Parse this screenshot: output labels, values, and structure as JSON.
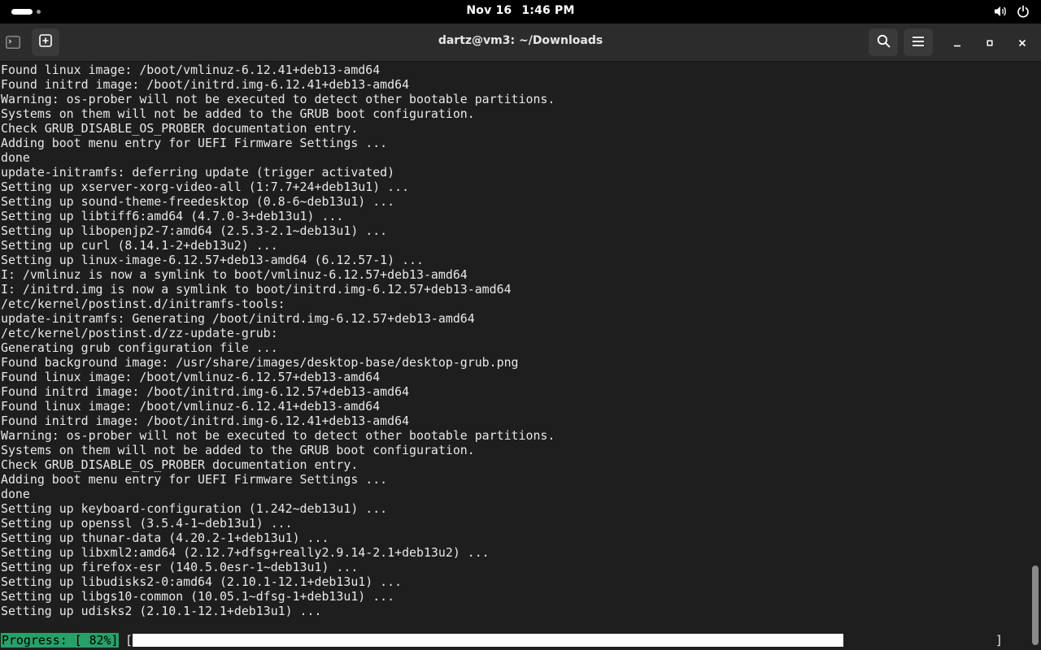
{
  "top_bar": {
    "date": "Nov 16",
    "time": "1:46 PM",
    "icons": [
      "activities-indicator",
      "volume-icon",
      "power-icon"
    ]
  },
  "window": {
    "title": "dartz@vm3: ~/Downloads",
    "icons": [
      "terminal-icon",
      "new-tab-icon",
      "search-icon",
      "hamburger-menu-icon",
      "minimize-icon",
      "maximize-icon",
      "close-icon"
    ]
  },
  "terminal": {
    "lines": [
      "Found linux image: /boot/vmlinuz-6.12.41+deb13-amd64",
      "Found initrd image: /boot/initrd.img-6.12.41+deb13-amd64",
      "Warning: os-prober will not be executed to detect other bootable partitions.",
      "Systems on them will not be added to the GRUB boot configuration.",
      "Check GRUB_DISABLE_OS_PROBER documentation entry.",
      "Adding boot menu entry for UEFI Firmware Settings ...",
      "done",
      "update-initramfs: deferring update (trigger activated)",
      "Setting up xserver-xorg-video-all (1:7.7+24+deb13u1) ...",
      "Setting up sound-theme-freedesktop (0.8-6~deb13u1) ...",
      "Setting up libtiff6:amd64 (4.7.0-3+deb13u1) ...",
      "Setting up libopenjp2-7:amd64 (2.5.3-2.1~deb13u1) ...",
      "Setting up curl (8.14.1-2+deb13u2) ...",
      "Setting up linux-image-6.12.57+deb13-amd64 (6.12.57-1) ...",
      "I: /vmlinuz is now a symlink to boot/vmlinuz-6.12.57+deb13-amd64",
      "I: /initrd.img is now a symlink to boot/initrd.img-6.12.57+deb13-amd64",
      "/etc/kernel/postinst.d/initramfs-tools:",
      "update-initramfs: Generating /boot/initrd.img-6.12.57+deb13-amd64",
      "/etc/kernel/postinst.d/zz-update-grub:",
      "Generating grub configuration file ...",
      "Found background image: /usr/share/images/desktop-base/desktop-grub.png",
      "Found linux image: /boot/vmlinuz-6.12.57+deb13-amd64",
      "Found initrd image: /boot/initrd.img-6.12.57+deb13-amd64",
      "Found linux image: /boot/vmlinuz-6.12.41+deb13-amd64",
      "Found initrd image: /boot/initrd.img-6.12.41+deb13-amd64",
      "Warning: os-prober will not be executed to detect other bootable partitions.",
      "Systems on them will not be added to the GRUB boot configuration.",
      "Check GRUB_DISABLE_OS_PROBER documentation entry.",
      "Adding boot menu entry for UEFI Firmware Settings ...",
      "done",
      "Setting up keyboard-configuration (1.242~deb13u1) ...",
      "Setting up openssl (3.5.4-1~deb13u1) ...",
      "Setting up thunar-data (4.20.2-1+deb13u1) ...",
      "Setting up libxml2:amd64 (2.12.7+dfsg+really2.9.14-2.1+deb13u2) ...",
      "Setting up firefox-esr (140.5.0esr-1~deb13u1) ...",
      "Setting up libudisks2-0:amd64 (2.10.1-12.1+deb13u1) ...",
      "Setting up libgs10-common (10.05.1~dfsg-1+deb13u1) ...",
      "Setting up udisks2 (2.10.1-12.1+deb13u1) ..."
    ],
    "progress": {
      "label": "Progress: [ 82%]",
      "open_bracket": "[",
      "close_bracket": "]",
      "fraction": 0.828
    }
  },
  "colors": {
    "terminal_bg": "#1e1e1e",
    "terminal_fg": "#e8e8e8",
    "progress_label_bg": "#26a269",
    "headerbar_bg": "#2c2c2c",
    "topbar_bg": "#000000"
  }
}
